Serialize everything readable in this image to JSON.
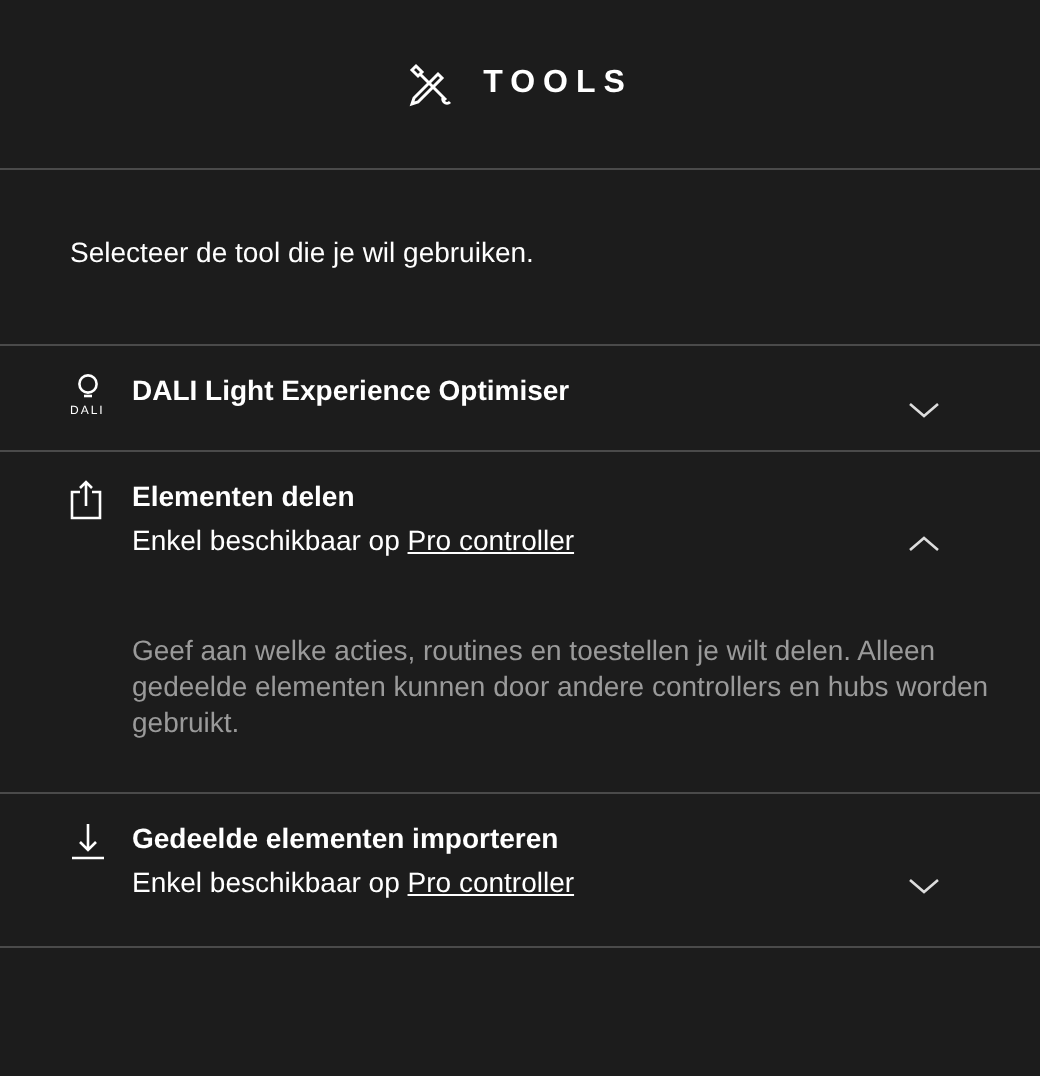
{
  "header": {
    "title": "TOOLS"
  },
  "intro": "Selecteer de tool die je wil gebruiken.",
  "tools": [
    {
      "kind": "bulb",
      "icon_label": "DALI",
      "title": "DALI Light Experience Optimiser",
      "expanded": false
    },
    {
      "kind": "share",
      "title": "Elementen delen",
      "subtitle": "Enkel beschikbaar op",
      "link": "Pro controller",
      "expanded": true,
      "description": "Geef aan welke acties, routines en toestellen je wilt delen. Alleen gedeelde elementen kunnen door andere controllers en hubs worden gebruikt."
    },
    {
      "kind": "import",
      "title": "Gedeelde elementen importeren",
      "subtitle": "Enkel beschikbaar op",
      "link": "Pro controller",
      "expanded": false
    }
  ]
}
